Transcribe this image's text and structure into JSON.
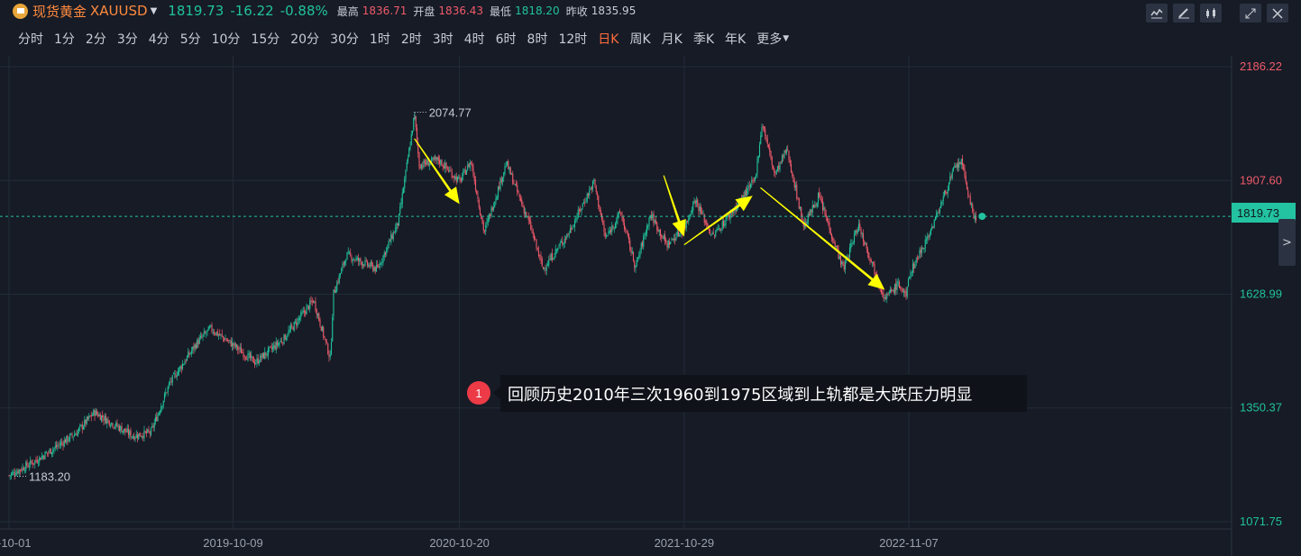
{
  "header": {
    "symbol_name": "现货黄金",
    "symbol_code": "XAUUSD",
    "last_price": "1819.73",
    "change": "-16.22",
    "change_pct": "-0.88%",
    "high_label": "最高",
    "high": "1836.71",
    "open_label": "开盘",
    "open": "1836.43",
    "low_label": "最低",
    "low": "1818.20",
    "prev_close_label": "昨收",
    "prev_close": "1835.95"
  },
  "periods": [
    "分时",
    "1分",
    "2分",
    "3分",
    "4分",
    "5分",
    "10分",
    "15分",
    "20分",
    "30分",
    "1时",
    "2时",
    "3时",
    "4时",
    "6时",
    "8时",
    "12时",
    "日K",
    "周K",
    "月K",
    "季K",
    "年K",
    "更多"
  ],
  "active_period": "日K",
  "toolbar_icons": [
    "indicator-icon",
    "draw-icon",
    "candle-style-icon",
    "expand-icon",
    "close-icon"
  ],
  "colors": {
    "background": "#161b26",
    "up": "#21c29b",
    "down": "#f05a6a",
    "arrow": "#ffff00",
    "grid": "#232c38"
  },
  "annotation": {
    "badge": "1",
    "text": "回顾历史2010年三次1960到1975区域到上轨都是大跌压力明显"
  },
  "chart_data": {
    "type": "candlestick",
    "x_ticks": [
      "-10-01",
      "2019-10-09",
      "2020-10-20",
      "2021-10-29",
      "2022-11-07"
    ],
    "y_ticks": [
      2186.22,
      1907.6,
      1628.99,
      1350.37,
      1071.75
    ],
    "y_tick_labels": [
      "2186.22",
      "1907.60",
      "1628.99",
      "1350.37",
      "1071.75"
    ],
    "ylim": [
      1071.75,
      2186.22
    ],
    "current_price": 1819.73,
    "current_price_label": "1819.73",
    "max_marker": {
      "date": "2020-08-06",
      "value": 2074.77,
      "label": "2074.77"
    },
    "min_marker": {
      "date": "2018-10-01",
      "value": 1183.2,
      "label": "1183.20"
    },
    "close_path": [
      [
        "2018-10-01",
        1185
      ],
      [
        "2018-11-15",
        1222
      ],
      [
        "2019-01-20",
        1288
      ],
      [
        "2019-02-20",
        1340
      ],
      [
        "2019-04-25",
        1282
      ],
      [
        "2019-05-25",
        1290
      ],
      [
        "2019-06-25",
        1410
      ],
      [
        "2019-08-10",
        1510
      ],
      [
        "2019-09-01",
        1545
      ],
      [
        "2019-10-09",
        1505
      ],
      [
        "2019-11-15",
        1462
      ],
      [
        "2019-12-31",
        1518
      ],
      [
        "2020-02-20",
        1615
      ],
      [
        "2020-03-19",
        1470
      ],
      [
        "2020-03-24",
        1630
      ],
      [
        "2020-04-15",
        1725
      ],
      [
        "2020-06-05",
        1690
      ],
      [
        "2020-07-10",
        1805
      ],
      [
        "2020-08-06",
        2068
      ],
      [
        "2020-08-14",
        1945
      ],
      [
        "2020-09-15",
        1958
      ],
      [
        "2020-10-20",
        1905
      ],
      [
        "2020-11-08",
        1955
      ],
      [
        "2020-11-30",
        1780
      ],
      [
        "2021-01-06",
        1950
      ],
      [
        "2021-02-15",
        1795
      ],
      [
        "2021-03-08",
        1690
      ],
      [
        "2021-04-20",
        1780
      ],
      [
        "2021-06-01",
        1905
      ],
      [
        "2021-06-20",
        1765
      ],
      [
        "2021-07-15",
        1830
      ],
      [
        "2021-08-09",
        1695
      ],
      [
        "2021-09-03",
        1825
      ],
      [
        "2021-09-30",
        1750
      ],
      [
        "2021-10-29",
        1790
      ],
      [
        "2021-11-16",
        1862
      ],
      [
        "2021-12-15",
        1770
      ],
      [
        "2022-01-25",
        1845
      ],
      [
        "2022-02-24",
        1910
      ],
      [
        "2022-03-08",
        2050
      ],
      [
        "2022-03-29",
        1920
      ],
      [
        "2022-04-18",
        1985
      ],
      [
        "2022-05-16",
        1795
      ],
      [
        "2022-06-10",
        1870
      ],
      [
        "2022-07-21",
        1690
      ],
      [
        "2022-08-15",
        1800
      ],
      [
        "2022-09-28",
        1618
      ],
      [
        "2022-10-21",
        1655
      ],
      [
        "2022-11-03",
        1620
      ],
      [
        "2022-11-07",
        1675
      ],
      [
        "2022-12-15",
        1790
      ],
      [
        "2023-01-20",
        1930
      ],
      [
        "2023-02-02",
        1955
      ],
      [
        "2023-02-24",
        1810
      ],
      [
        "2023-02-28",
        1819.73
      ]
    ],
    "arrows": [
      {
        "from": [
          "2020-08-06",
          2010
        ],
        "to": [
          "2020-10-20",
          1850
        ]
      },
      {
        "from": [
          "2021-09-25",
          1920
        ],
        "to": [
          "2021-10-29",
          1770
        ]
      },
      {
        "from": [
          "2021-10-29",
          1750
        ],
        "to": [
          "2022-02-20",
          1870
        ]
      },
      {
        "from": [
          "2022-03-05",
          1890
        ],
        "to": [
          "2022-09-28",
          1640
        ]
      }
    ]
  }
}
